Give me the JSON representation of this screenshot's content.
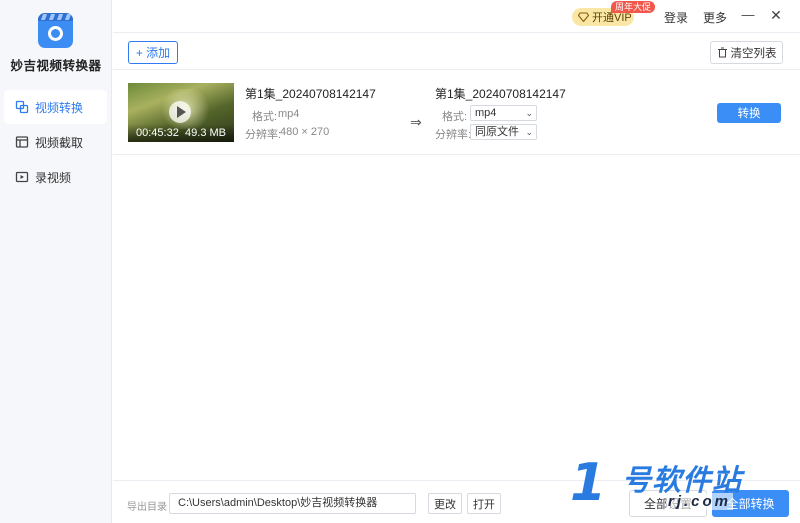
{
  "app": {
    "name": "妙吉视频转换器"
  },
  "sidebar": {
    "items": [
      {
        "label": "视频转换",
        "icon": "convert-icon",
        "active": true
      },
      {
        "label": "视频截取",
        "icon": "crop-icon",
        "active": false
      },
      {
        "label": "录视频",
        "icon": "record-icon",
        "active": false
      }
    ]
  },
  "topbar": {
    "vip_label": "开通VIP",
    "promo_tag": "周年大促",
    "login_label": "登录",
    "more_label": "更多",
    "minimize_label": "—",
    "close_label": "✕"
  },
  "toolbar": {
    "add_label": "+ 添加",
    "clear_label": "清空列表"
  },
  "file": {
    "thumb_duration": "00:45:32",
    "thumb_size": "49.3 MB",
    "source": {
      "name": "第1集_20240708142147",
      "format_label": "格式:",
      "format_value": "mp4",
      "resolution_label": "分辨率:",
      "resolution_value": "480 × 270"
    },
    "arrow": "⇒",
    "target": {
      "name": "第1集_20240708142147",
      "format_label": "格式:",
      "format_value": "mp4",
      "resolution_label": "分辨率:",
      "resolution_value": "同原文件"
    },
    "convert_label": "转换"
  },
  "bottom": {
    "output_label": "导出目录",
    "output_path": "C:\\Users\\admin\\Desktop\\妙吉视频转换器",
    "change_label": "更改",
    "open_label": "打开",
    "all_settings_label": "全部设置",
    "all_convert_label": "全部转换"
  },
  "watermark": {
    "number": "1",
    "text": "号软件站",
    "url": "rj.com"
  },
  "colors": {
    "accent": "#3a8ef5",
    "sidebar_bg": "#f5f7fb",
    "vip_bg": "#fbe7a5",
    "promo": "#f1574b"
  }
}
